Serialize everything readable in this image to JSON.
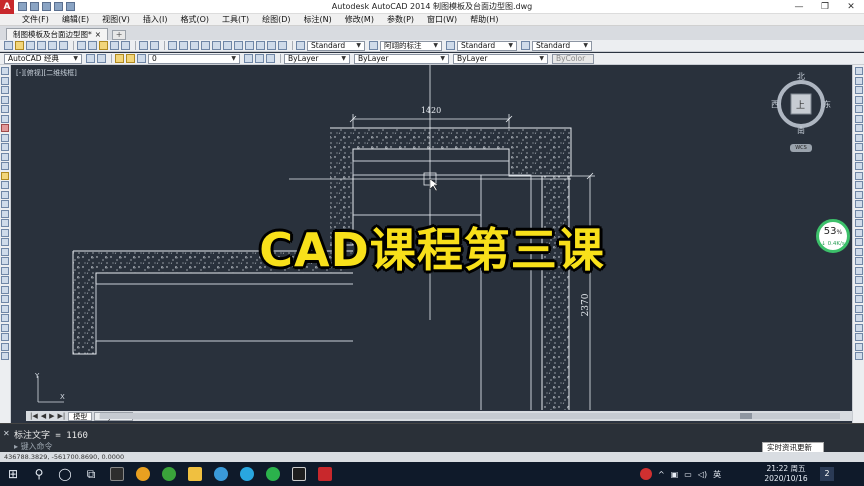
{
  "window": {
    "app_title": "Autodesk AutoCAD 2014    制图模板及台面边型图.dwg",
    "logo": "A",
    "controls": [
      "—",
      "❐",
      "✕"
    ]
  },
  "menu": [
    "文件(F)",
    "编辑(E)",
    "视图(V)",
    "插入(I)",
    "格式(O)",
    "工具(T)",
    "绘图(D)",
    "标注(N)",
    "修改(M)",
    "参数(P)",
    "窗口(W)",
    "帮助(H)"
  ],
  "file_tab": {
    "label": "制图模板及台面边型图*",
    "close": "×"
  },
  "toolbar_styles": {
    "text_style": "Standard",
    "dim_style": "阿翊的标注",
    "table_style": "Standard",
    "mleader_style": "Standard"
  },
  "toolbar_props": {
    "workspace": "AutoCAD 经典",
    "layer": "0",
    "color": "ByLayer",
    "linetype": "ByLayer",
    "lineweight": "ByLayer",
    "plotstyle": "ByColor"
  },
  "viewport_label": "[-][俯视][二维线框]",
  "dimensions": {
    "horizontal": "1420",
    "vertical": "2370"
  },
  "overlay_title": "CAD课程第三课",
  "viewcube": {
    "north": "北",
    "south": "南",
    "east": "东",
    "west": "西",
    "top": "上",
    "wcs": "WCS"
  },
  "network": {
    "percent": "53",
    "unit": "%",
    "speed": "↓ 0.4K/s"
  },
  "layout_tabs": {
    "nav": [
      "|◀",
      "◀",
      "▶",
      "▶|"
    ],
    "model": "模型",
    "layout1": "Layout1"
  },
  "command": {
    "history": "标注文字 = 1160",
    "prompt": "键入命令"
  },
  "coords": "436788.3829, -561700.8690, 0.0000",
  "notification": "实时资讯更新",
  "clock": {
    "time": "21:22 周五",
    "date": "2020/10/16"
  },
  "tray": {
    "lang": "英",
    "chevron": "^",
    "badge": "2"
  }
}
